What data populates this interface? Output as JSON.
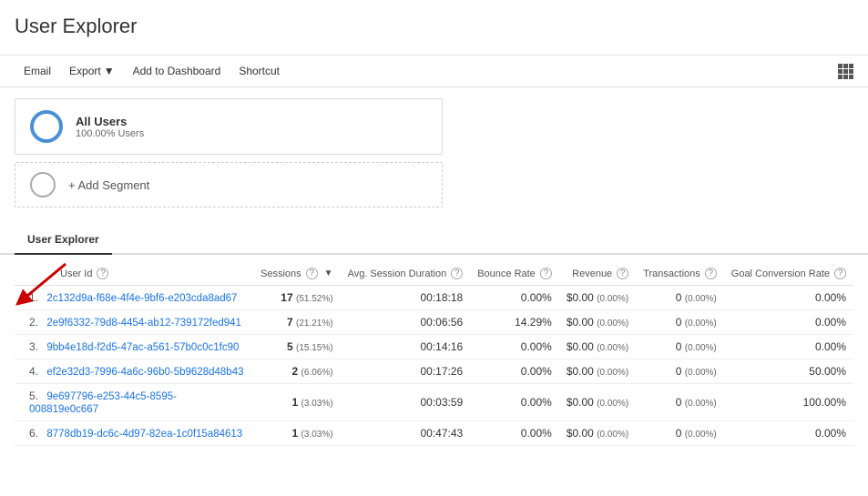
{
  "page": {
    "title": "User Explorer"
  },
  "toolbar": {
    "email_label": "Email",
    "export_label": "Export",
    "add_to_dashboard_label": "Add to Dashboard",
    "shortcut_label": "Shortcut"
  },
  "segment": {
    "name": "All Users",
    "sub": "100.00% Users",
    "add_label": "+ Add Segment"
  },
  "tab": {
    "label": "User Explorer"
  },
  "table": {
    "headers": {
      "user_id": "User Id",
      "sessions": "Sessions",
      "avg_session_duration": "Avg. Session Duration",
      "bounce_rate": "Bounce Rate",
      "revenue": "Revenue",
      "transactions": "Transactions",
      "goal_conversion_rate": "Goal Conversion Rate"
    },
    "rows": [
      {
        "num": "1.",
        "user_id": "2c132d9a-f68e-4f4e-9bf6-e203cda8ad67",
        "sessions": "17",
        "sessions_pct": "51.52%",
        "avg_duration": "00:18:18",
        "bounce_rate": "0.00%",
        "revenue": "$0.00",
        "revenue_pct": "0.00%",
        "transactions": "0",
        "transactions_pct": "0.00%",
        "goal_conversion": "0.00%"
      },
      {
        "num": "2.",
        "user_id": "2e9f6332-79d8-4454-ab12-739172fed941",
        "sessions": "7",
        "sessions_pct": "21.21%",
        "avg_duration": "00:06:56",
        "bounce_rate": "14.29%",
        "revenue": "$0.00",
        "revenue_pct": "0.00%",
        "transactions": "0",
        "transactions_pct": "0.00%",
        "goal_conversion": "0.00%"
      },
      {
        "num": "3.",
        "user_id": "9bb4e18d-f2d5-47ac-a561-57b0c0c1fc90",
        "sessions": "5",
        "sessions_pct": "15.15%",
        "avg_duration": "00:14:16",
        "bounce_rate": "0.00%",
        "revenue": "$0.00",
        "revenue_pct": "0.00%",
        "transactions": "0",
        "transactions_pct": "0.00%",
        "goal_conversion": "0.00%"
      },
      {
        "num": "4.",
        "user_id": "ef2e32d3-7996-4a6c-96b0-5b9628d48b43",
        "sessions": "2",
        "sessions_pct": "6.06%",
        "avg_duration": "00:17:26",
        "bounce_rate": "0.00%",
        "revenue": "$0.00",
        "revenue_pct": "0.00%",
        "transactions": "0",
        "transactions_pct": "0.00%",
        "goal_conversion": "50.00%"
      },
      {
        "num": "5.",
        "user_id": "9e697796-e253-44c5-8595-008819e0c667",
        "sessions": "1",
        "sessions_pct": "3.03%",
        "avg_duration": "00:03:59",
        "bounce_rate": "0.00%",
        "revenue": "$0.00",
        "revenue_pct": "0.00%",
        "transactions": "0",
        "transactions_pct": "0.00%",
        "goal_conversion": "100.00%"
      },
      {
        "num": "6.",
        "user_id": "8778db19-dc6c-4d97-82ea-1c0f15a84613",
        "sessions": "1",
        "sessions_pct": "3.03%",
        "avg_duration": "00:47:43",
        "bounce_rate": "0.00%",
        "revenue": "$0.00",
        "revenue_pct": "0.00%",
        "transactions": "0",
        "transactions_pct": "0.00%",
        "goal_conversion": "0.00%"
      }
    ]
  }
}
